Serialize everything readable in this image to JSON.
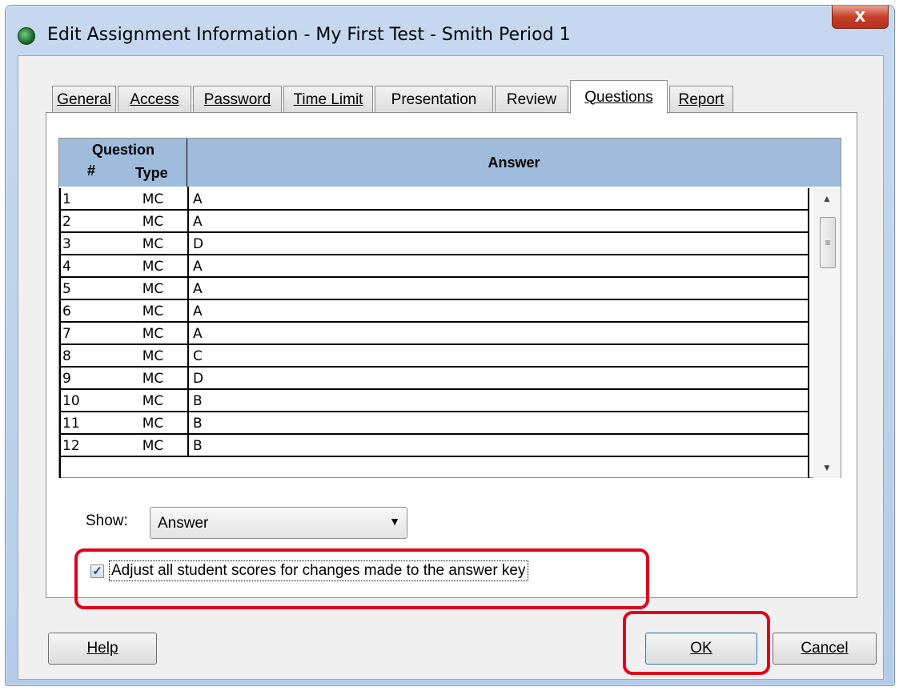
{
  "window": {
    "title": "Edit Assignment Information - My First Test - Smith Period 1",
    "close_glyph": "X"
  },
  "tabs": [
    {
      "label": "General",
      "active": false
    },
    {
      "label": "Access",
      "active": false
    },
    {
      "label": "Password",
      "active": false
    },
    {
      "label": "Time Limit",
      "active": false
    },
    {
      "label": "Presentation",
      "active": false
    },
    {
      "label": "Review",
      "active": false
    },
    {
      "label": "Questions",
      "active": true
    },
    {
      "label": "Report",
      "active": false
    }
  ],
  "grid": {
    "header": {
      "question": "Question",
      "num": "#",
      "type": "Type",
      "answer": "Answer"
    },
    "rows": [
      {
        "num": "1",
        "type": "MC",
        "answer": "A"
      },
      {
        "num": "2",
        "type": "MC",
        "answer": "A"
      },
      {
        "num": "3",
        "type": "MC",
        "answer": "D"
      },
      {
        "num": "4",
        "type": "MC",
        "answer": "A"
      },
      {
        "num": "5",
        "type": "MC",
        "answer": "A"
      },
      {
        "num": "6",
        "type": "MC",
        "answer": "A"
      },
      {
        "num": "7",
        "type": "MC",
        "answer": "A"
      },
      {
        "num": "8",
        "type": "MC",
        "answer": "C"
      },
      {
        "num": "9",
        "type": "MC",
        "answer": "D"
      },
      {
        "num": "10",
        "type": "MC",
        "answer": "B"
      },
      {
        "num": "11",
        "type": "MC",
        "answer": "B"
      },
      {
        "num": "12",
        "type": "MC",
        "answer": "B"
      }
    ]
  },
  "show": {
    "label": "Show:",
    "selected": "Answer"
  },
  "adjust": {
    "checked": true,
    "label": "Adjust all student scores for changes made to the answer key"
  },
  "buttons": {
    "help": "Help",
    "ok": "OK",
    "cancel": "Cancel"
  },
  "colors": {
    "grid_header": "#9fbcdc",
    "highlight": "#e0001b",
    "close_button": "#c7402a"
  }
}
